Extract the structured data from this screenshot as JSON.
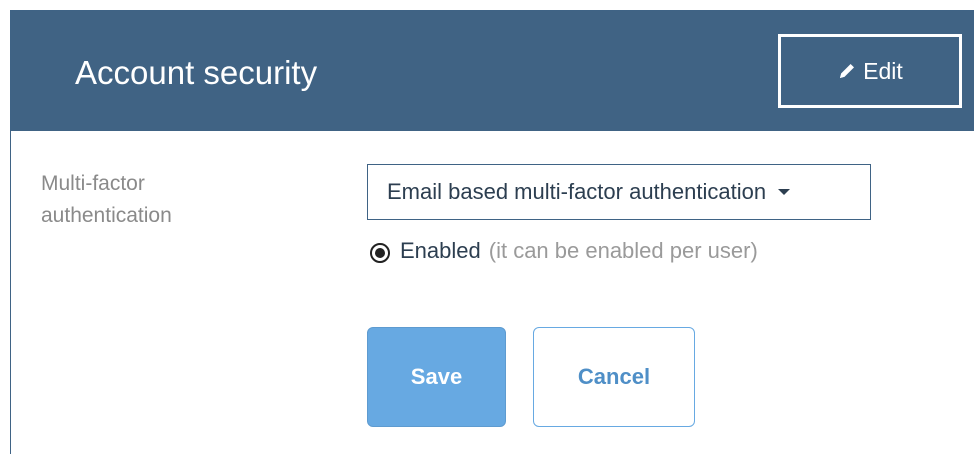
{
  "header": {
    "title": "Account security",
    "edit_label": "Edit",
    "edit_icon": "pencil-icon"
  },
  "mfa": {
    "label": "Multi-factor authentication",
    "selected_option": "Email based multi-factor authentication",
    "radio_label": "Enabled",
    "radio_hint": "(it can be enabled per user)",
    "radio_checked": true
  },
  "actions": {
    "save_label": "Save",
    "cancel_label": "Cancel"
  },
  "colors": {
    "header_bg": "#406384",
    "primary": "#67a9e2"
  }
}
